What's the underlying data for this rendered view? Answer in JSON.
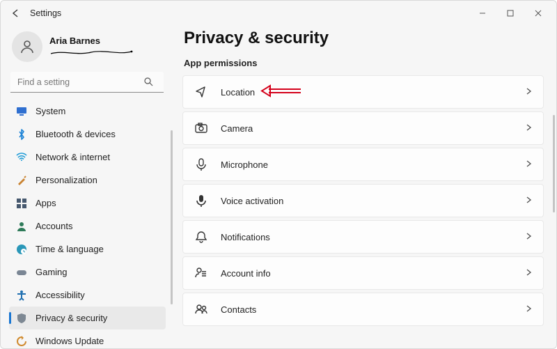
{
  "window": {
    "title": "Settings"
  },
  "profile": {
    "name": "Aria Barnes"
  },
  "search": {
    "placeholder": "Find a setting"
  },
  "sidebar": {
    "items": [
      {
        "label": "System",
        "icon": "monitor-icon",
        "color": "#2f6fd0"
      },
      {
        "label": "Bluetooth & devices",
        "icon": "bluetooth-icon",
        "color": "#1c83d6"
      },
      {
        "label": "Network & internet",
        "icon": "wifi-icon",
        "color": "#1c9ad6"
      },
      {
        "label": "Personalization",
        "icon": "paintbrush-icon",
        "color": "#c98433"
      },
      {
        "label": "Apps",
        "icon": "apps-icon",
        "color": "#46586e"
      },
      {
        "label": "Accounts",
        "icon": "person-icon",
        "color": "#2e7a59"
      },
      {
        "label": "Time & language",
        "icon": "globe-clock-icon",
        "color": "#2a97b8"
      },
      {
        "label": "Gaming",
        "icon": "gamepad-icon",
        "color": "#7a8694"
      },
      {
        "label": "Accessibility",
        "icon": "accessibility-icon",
        "color": "#1f6fb0"
      },
      {
        "label": "Privacy & security",
        "icon": "shield-icon",
        "color": "#7d8893",
        "active": true
      },
      {
        "label": "Windows Update",
        "icon": "update-icon",
        "color": "#d08a2e"
      }
    ]
  },
  "page": {
    "title": "Privacy & security",
    "section": "App permissions"
  },
  "permissions": [
    {
      "label": "Location",
      "icon": "location-icon"
    },
    {
      "label": "Camera",
      "icon": "camera-icon"
    },
    {
      "label": "Microphone",
      "icon": "microphone-icon"
    },
    {
      "label": "Voice activation",
      "icon": "voice-icon"
    },
    {
      "label": "Notifications",
      "icon": "bell-icon"
    },
    {
      "label": "Account info",
      "icon": "account-info-icon"
    },
    {
      "label": "Contacts",
      "icon": "contacts-icon"
    }
  ]
}
